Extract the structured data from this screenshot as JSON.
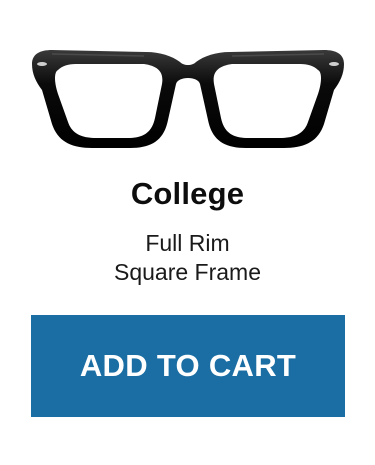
{
  "product": {
    "name": "College",
    "rim_type": "Full Rim",
    "frame_shape": "Square Frame",
    "image_icon": "eyeglasses-icon",
    "frame_color": "#0a0a0a"
  },
  "actions": {
    "add_to_cart_label": "ADD TO CART",
    "button_color": "#1a6ea3"
  }
}
